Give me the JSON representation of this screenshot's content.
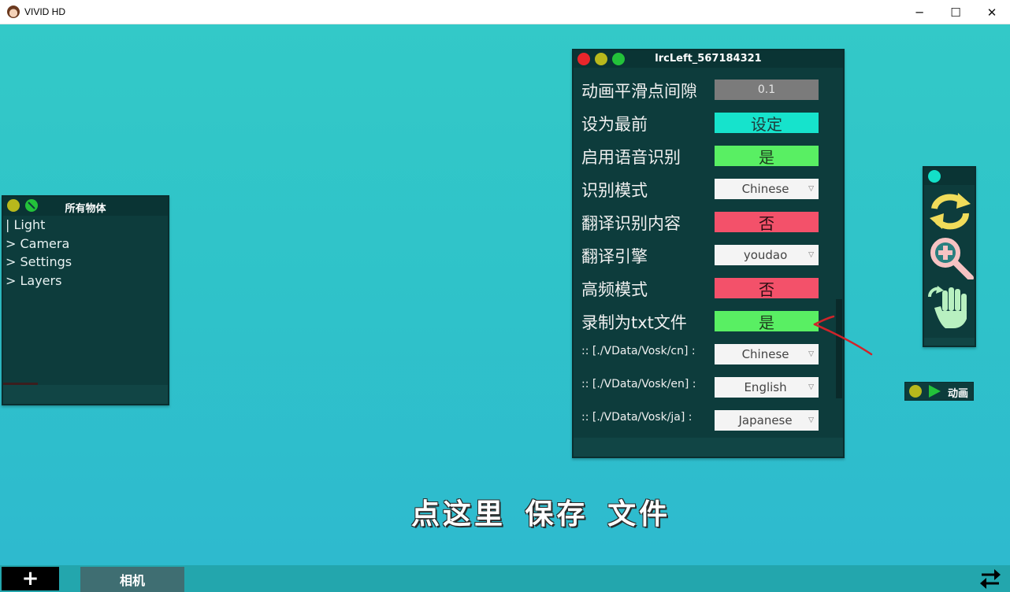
{
  "window": {
    "title": "VIVID HD",
    "minimize_glyph": "─",
    "maximize_glyph": "☐",
    "close_glyph": "✕"
  },
  "objects_panel": {
    "title": "所有物体",
    "items": [
      "| Light",
      "> Camera",
      "> Settings",
      "> Layers"
    ]
  },
  "settings_panel": {
    "title": "lrcLeft_567184321",
    "rows": [
      {
        "label": "动画平滑点间隙",
        "value": "0.1",
        "kind": "field"
      },
      {
        "label": "设为最前",
        "value": "设定",
        "kind": "cyan"
      },
      {
        "label": "启用语音识别",
        "value": "是",
        "kind": "green"
      },
      {
        "label": "识别模式",
        "value": "Chinese",
        "kind": "select"
      },
      {
        "label": "翻译识别内容",
        "value": "否",
        "kind": "red"
      },
      {
        "label": "翻译引擎",
        "value": "youdao",
        "kind": "select"
      },
      {
        "label": "高频模式",
        "value": "否",
        "kind": "red"
      },
      {
        "label": "录制为txt文件",
        "value": "是",
        "kind": "green"
      },
      {
        "label": ":: [./VData/Vosk/cn] :",
        "value": "Chinese",
        "kind": "select"
      },
      {
        "label": ":: [./VData/Vosk/en] :",
        "value": "English",
        "kind": "select"
      },
      {
        "label": ":: [./VData/Vosk/ja] :",
        "value": "Japanese",
        "kind": "select"
      }
    ]
  },
  "tools_panel": {
    "icons": [
      "refresh-icon",
      "zoom-in-icon",
      "hand-rotate-icon"
    ]
  },
  "anim_chip": {
    "label": "动画"
  },
  "caption": "点这里 保存 文件",
  "bottom_bar": {
    "add_label": "+",
    "camera_tab": "相机"
  },
  "colors": {
    "background": "#2fc4c4",
    "panel": "#0d3c3c",
    "cyan": "#16e3cc",
    "green": "#59ef63",
    "red": "#f3516a"
  }
}
